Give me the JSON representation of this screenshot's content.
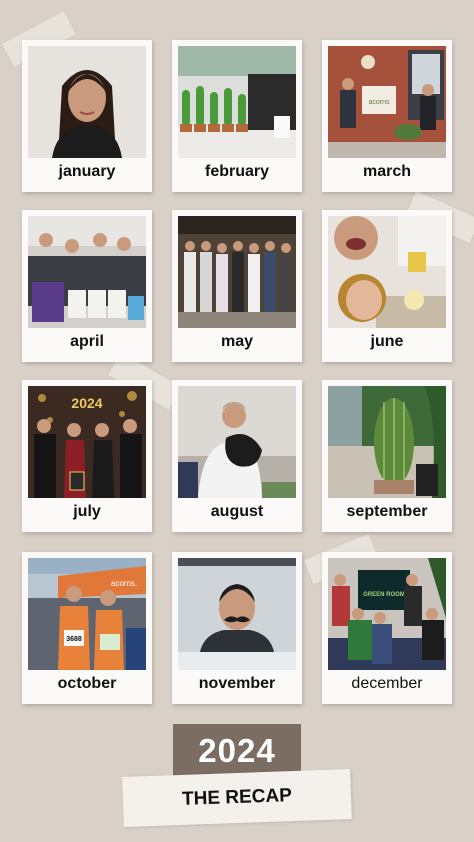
{
  "months": [
    {
      "label": "january"
    },
    {
      "label": "february"
    },
    {
      "label": "march"
    },
    {
      "label": "april"
    },
    {
      "label": "may"
    },
    {
      "label": "june"
    },
    {
      "label": "july"
    },
    {
      "label": "august"
    },
    {
      "label": "september"
    },
    {
      "label": "october"
    },
    {
      "label": "november"
    },
    {
      "label": "december"
    }
  ],
  "photo_text": {
    "march_sign": "acorns",
    "july_banner": "2024",
    "october_banner": "acorns.",
    "october_bib_1": "3688",
    "december_screen": "GREEN ROOM"
  },
  "footer": {
    "year": "2024",
    "title": "THE RECAP"
  },
  "colors": {
    "background": "#d9d1c7",
    "year_block": "#7b6d62",
    "recap_block": "#f4f1ec"
  }
}
